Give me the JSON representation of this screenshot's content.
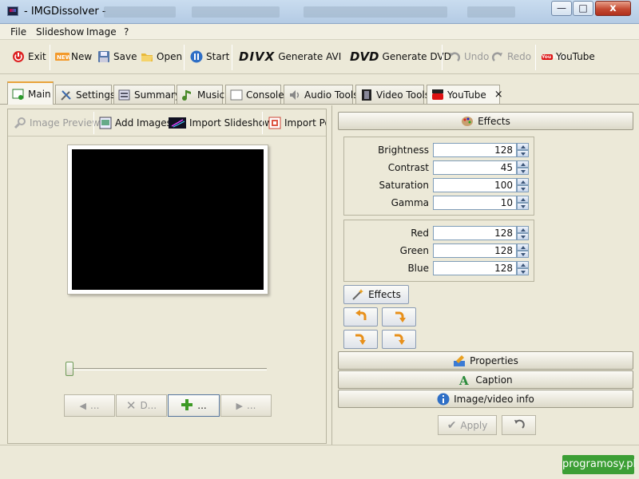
{
  "window": {
    "title": "- IMGDissolver -",
    "min_label": "0",
    "max_label": "1",
    "close_label": "x"
  },
  "menubar": {
    "items": [
      "File",
      "Slideshow",
      "Image",
      "?"
    ]
  },
  "toolbar": {
    "exit": "Exit",
    "new": "New",
    "save": "Save",
    "open": "Open",
    "start": "Start",
    "divx_logo": "DIVX",
    "generate_avi": "Generate AVI",
    "dvd_logo": "DVD",
    "generate_dvd": "Generate DVD",
    "undo": "Undo",
    "redo": "Redo",
    "youtube_logo": "You Tube",
    "youtube": "YouTube"
  },
  "tabs": [
    "Main",
    "Settings",
    "Summary",
    "Music",
    "Console",
    "Audio Tools",
    "Video Tools",
    "YouTube"
  ],
  "tab_close": "×",
  "left_toolbar": {
    "image_preview": "Image Preview",
    "add_images": "Add Images",
    "import_slideshow": "Import Slideshow",
    "import_pow": "Import Pow"
  },
  "nav_buttons": {
    "prev": "...",
    "delete": "D...",
    "add": "...",
    "next": "..."
  },
  "right": {
    "effects_header": "Effects",
    "adjust1": [
      {
        "label": "Brightness",
        "value": "128"
      },
      {
        "label": "Contrast",
        "value": "45"
      },
      {
        "label": "Saturation",
        "value": "100"
      },
      {
        "label": "Gamma",
        "value": "10"
      }
    ],
    "adjust2": [
      {
        "label": "Red",
        "value": "128"
      },
      {
        "label": "Green",
        "value": "128"
      },
      {
        "label": "Blue",
        "value": "128"
      }
    ],
    "effects_button": "Effects",
    "properties_header": "Properties",
    "caption_header": "Caption",
    "info_header": "Image/video info",
    "apply": "Apply"
  },
  "watermark": "programosy.pl",
  "colors": {
    "accent_tab": "#e8a33a",
    "field_border": "#7f9db9",
    "watermark_bg": "#3c9f35"
  }
}
